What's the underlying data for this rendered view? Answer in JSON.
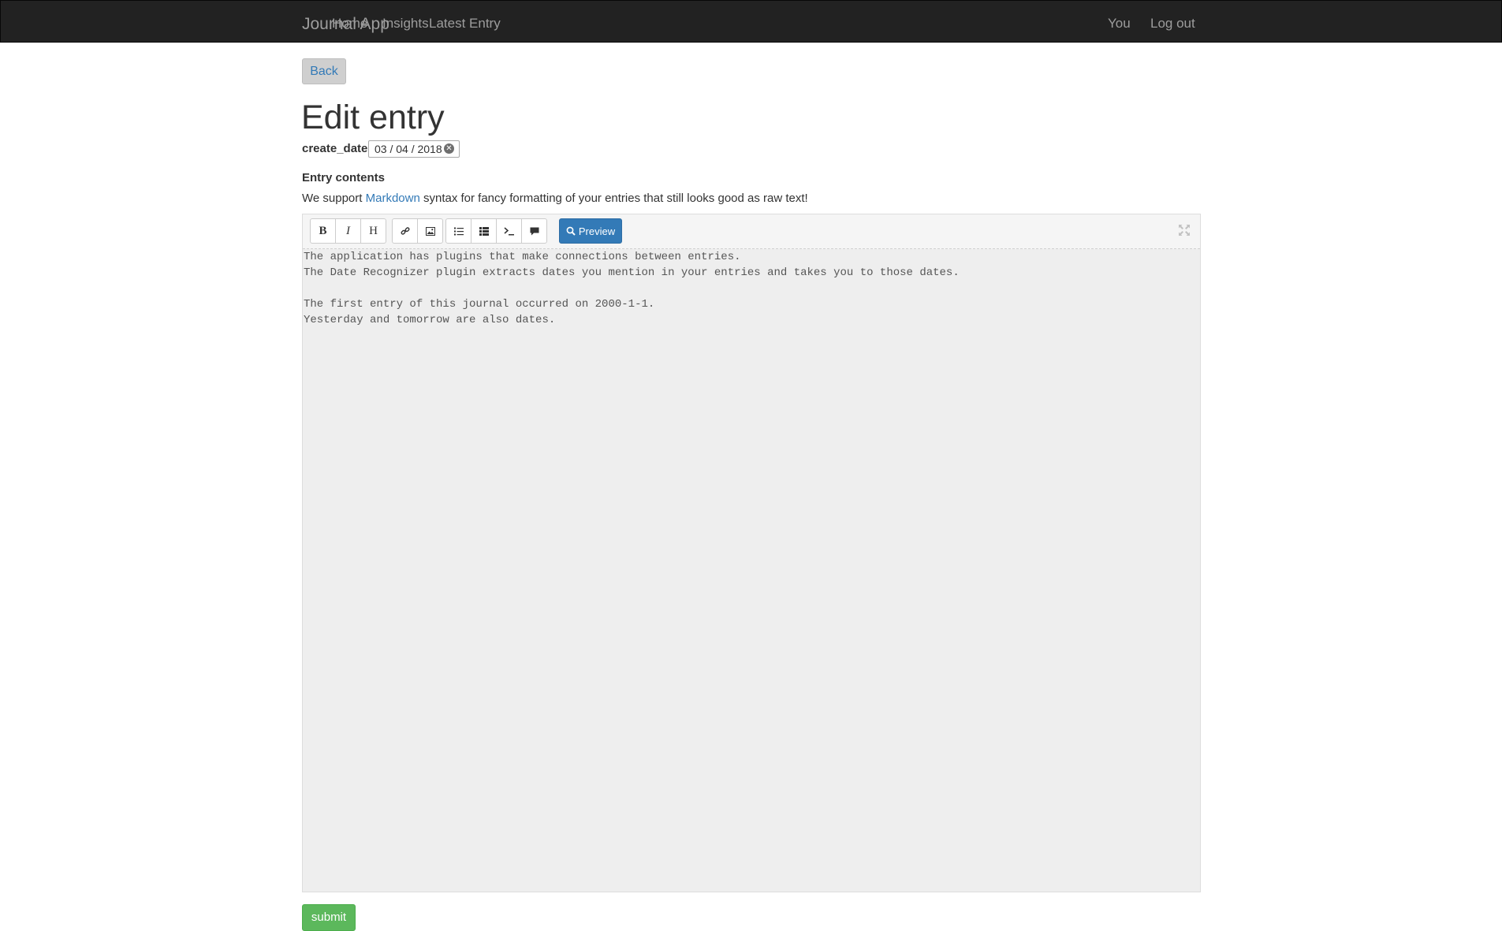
{
  "navbar": {
    "brand": "Journal App",
    "left_links": [
      "Home",
      "Insights",
      "Latest Entry"
    ],
    "right_links": [
      "You",
      "Log out"
    ]
  },
  "back_button": "Back",
  "page_title": "Edit entry",
  "date_field": {
    "label": "create_date",
    "value": "03 / 04 / 2018",
    "clear_icon": "clear-circle-icon"
  },
  "contents": {
    "label": "Entry contents",
    "help_prefix": "We support ",
    "help_link": "Markdown",
    "help_suffix": " syntax for fancy formatting of your entries that still looks good as raw text!"
  },
  "editor": {
    "toolbar_icons": [
      "bold-icon",
      "italic-icon",
      "heading-icon",
      "link-icon",
      "image-icon",
      "unordered-list-icon",
      "ordered-list-icon",
      "code-icon",
      "quote-icon",
      "search-icon",
      "fullscreen-icon"
    ],
    "bold_glyph": "B",
    "italic_glyph": "I",
    "heading_glyph": "H",
    "preview_label": "Preview",
    "text": "The application has plugins that make connections between entries.\nThe Date Recognizer plugin extracts dates you mention in your entries and takes you to those dates.\n\nThe first entry of this journal occurred on 2000-1-1.\nYesterday and tomorrow are also dates."
  },
  "submit_button": "submit",
  "colors": {
    "navbar_bg": "#222222",
    "link": "#337ab7",
    "primary": "#337ab7",
    "success": "#5cb85c"
  }
}
